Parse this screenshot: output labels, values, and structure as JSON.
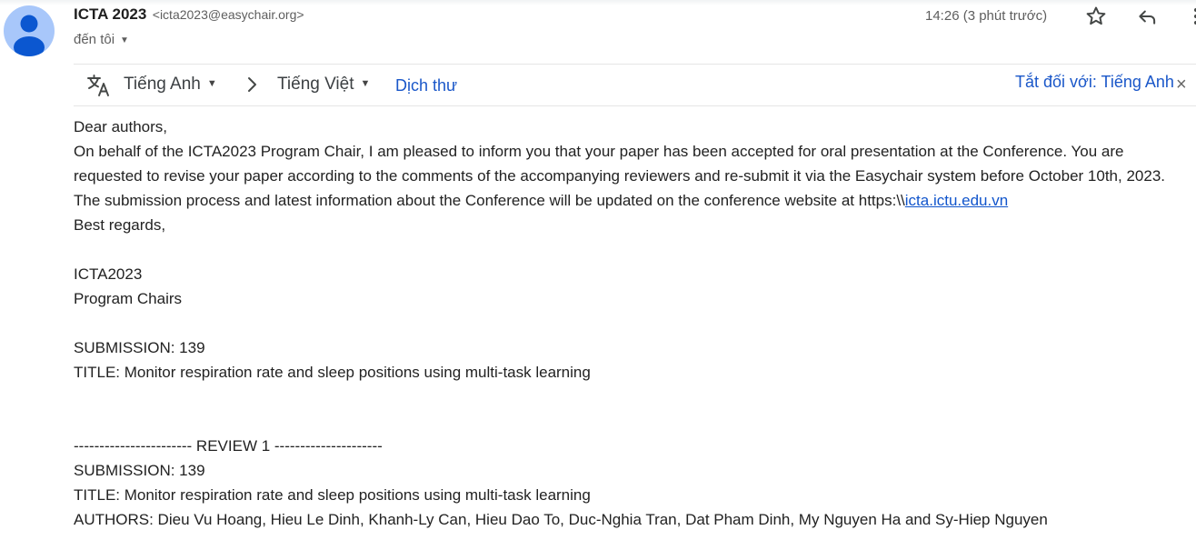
{
  "header": {
    "sender_name": "ICTA 2023",
    "sender_email": "<icta2023@easychair.org>",
    "recipient": "đến tôi",
    "timestamp": "14:26 (3 phút trước)"
  },
  "translate_bar": {
    "source_language": "Tiếng Anh",
    "target_language": "Tiếng Việt",
    "translate_label": "Dịch thư",
    "turn_off_label": "Tắt đối với: Tiếng Anh",
    "close": "×"
  },
  "body": {
    "greeting": "Dear authors,",
    "paragraph_text": "On behalf of the ICTA2023 Program Chair, I am pleased to inform you that your paper has been accepted for oral presentation at the Conference. You are requested to revise your paper according to the comments of the accompanying reviewers and re-submit it via the Easychair system before October 10th, 2023. The submission process and latest information about the Conference will be updated on the conference website at https:\\\\",
    "paragraph_link": "icta.ictu.edu.vn",
    "closing": "Best regards,",
    "signature_line1": "ICTA2023",
    "signature_line2": "Program Chairs",
    "submission": "SUBMISSION: 139",
    "title": "TITLE: Monitor respiration rate and sleep positions using multi-task learning",
    "review_header": "----------------------- REVIEW 1 ---------------------",
    "review_submission": "SUBMISSION: 139",
    "review_title": "TITLE: Monitor respiration rate and sleep positions using multi-task learning",
    "review_authors": "AUTHORS: Dieu Vu Hoang, Hieu Le Dinh, Khanh-Ly Can, Hieu Dao To, Duc-Nghia Tran, Dat Pham Dinh, My Nguyen Ha and Sy-Hiep Nguyen"
  },
  "colors": {
    "link": "#1155cc",
    "translate_link": "#1a57c9",
    "avatar_bg": "#a8c7fa",
    "avatar_fg": "#0b57d0"
  },
  "icons": [
    "person-avatar-icon",
    "star-icon",
    "reply-icon",
    "more-vert-icon",
    "translate-icon",
    "chevron-right-icon",
    "caret-down-icon",
    "close-icon"
  ]
}
